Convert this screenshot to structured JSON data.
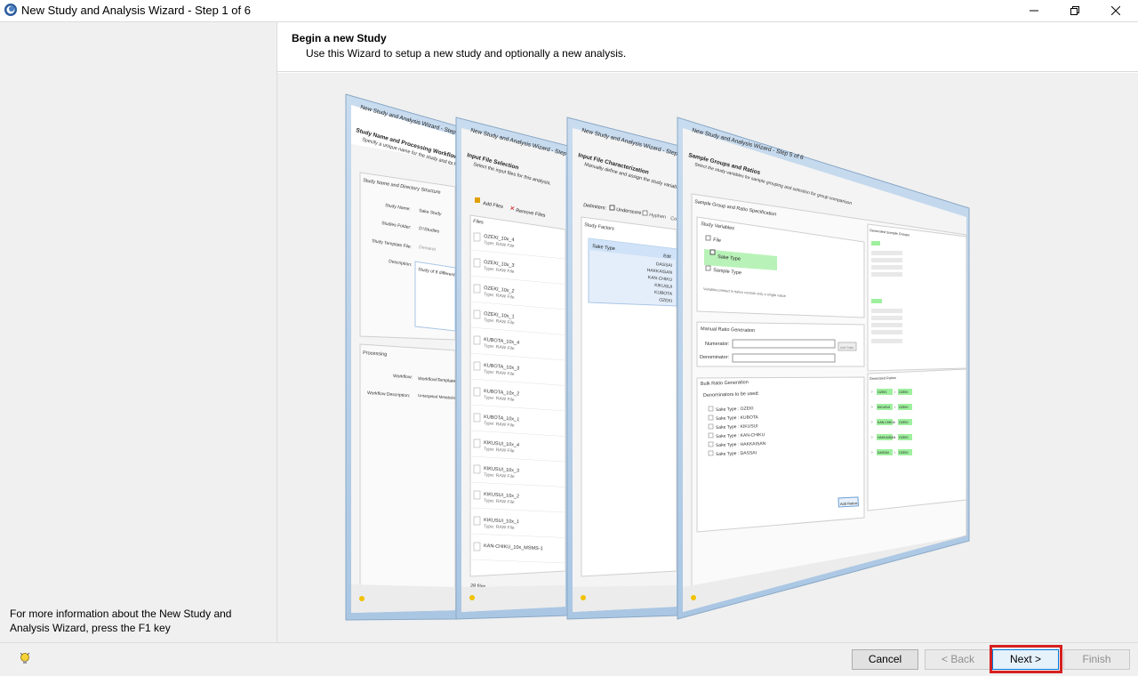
{
  "window": {
    "title": "New Study and Analysis Wizard - Step 1 of 6"
  },
  "header": {
    "title": "Begin a new Study",
    "subtitle": "Use this Wizard to setup a new study and optionally a new analysis."
  },
  "sidebar": {
    "help_text": "For more information about the New Study and Analysis Wizard, press the F1 key"
  },
  "footer": {
    "cancel_label": "Cancel",
    "back_label": "< Back",
    "next_label": "Next >",
    "finish_label": "Finish"
  },
  "preview": {
    "screen1": {
      "window_title": "New Study and Analysis Wizard - Step 2 of 6",
      "heading": "Study Name and Processing Workflow",
      "subheading": "Specify a unique name for the study and its ha",
      "group1": "Study Name and Directory Structure",
      "study_name_label": "Study Name:",
      "study_name_value": "Sake Study",
      "studies_folder_label": "Studies Folder:",
      "studies_folder_value": "D:\\Studies",
      "template_label": "Study Template File:",
      "template_value": "Demand",
      "description_label": "Description:",
      "description_value": "Study of 8 different sa",
      "group2": "Processing",
      "workflow_label": "Workflow:",
      "workflow_value": "Workflow\\Templates\\",
      "workflow_desc_label": "Workflow Description:",
      "workflow_desc_value": "Untargeted Metabolo Background (using bl values, fold change, G"
    },
    "screen2": {
      "window_title": "New Study and Analysis Wizard - Step 3 of 6",
      "heading": "Input File Selection",
      "subheading": "Select the input files for this analysis.",
      "add_files": "Add Files",
      "remove_files": "Remove Files",
      "files_header": "Files",
      "files": [
        {
          "name": "OZEKI_10x_4",
          "type": "Type: RAW File"
        },
        {
          "name": "OZEKI_10x_3",
          "type": "Type: RAW File"
        },
        {
          "name": "OZEKI_10x_2",
          "type": "Type: RAW File"
        },
        {
          "name": "OZEKI_10x_1",
          "type": "Type: RAW File"
        },
        {
          "name": "KUBOTA_10x_4",
          "type": "Type: RAW File"
        },
        {
          "name": "KUBOTA_10x_3",
          "type": "Type: RAW File"
        },
        {
          "name": "KUBOTA_10x_2",
          "type": "Type: RAW File"
        },
        {
          "name": "KUBOTA_10x_1",
          "type": "Type: RAW File"
        },
        {
          "name": "KIKUSUI_10x_4",
          "type": "Type: RAW File"
        },
        {
          "name": "KIKUSUI_10x_3",
          "type": "Type: RAW File"
        },
        {
          "name": "KIKUSUI_10x_2",
          "type": "Type: RAW File"
        },
        {
          "name": "KIKUSUI_10x_1",
          "type": "Type: RAW File"
        },
        {
          "name": "KAN-CHIKU_10x_MSMS-1",
          "type": ""
        }
      ],
      "file_count": "28 files"
    },
    "screen3": {
      "window_title": "New Study and Analysis Wizard - Step 4 of 6",
      "heading": "Input File Characterization",
      "subheading": "Manually define and assign the study variable",
      "delimiters_label": "Delimiters:",
      "underscore": "Underscore",
      "hyphen": "Hyphen",
      "other": "Co",
      "study_factors": "Study Factors",
      "factor": "Sake Type",
      "edit": "Edit",
      "values": [
        "DASSAI",
        "HAKKAISAN",
        "KAN-CHIKU",
        "KIKUSUI",
        "KUBOTA",
        "OZEKI"
      ]
    },
    "screen4": {
      "window_title": "New Study and Analysis Wizard - Step 5 of 6",
      "heading": "Sample Groups and Ratios",
      "subheading": "Select the study variables for sample grouping and selection for group comparison",
      "group_spec": "Sample Group and Ratio Specification",
      "study_variables": "Study Variables",
      "variables": [
        "File",
        "Sake Type",
        "Sample Type"
      ],
      "variables_note": "Variables printed in italics contain only a single value",
      "manual_ratio": "Manual Ratio Generation",
      "numerator": "Numerator:",
      "denominator": "Denominator:",
      "add_ratio": "Add Ratio",
      "bulk_ratio": "Bulk Ratio Generation",
      "denominators_used": "Denominators to be used:",
      "denominators": [
        "Sake Type : OZEKI",
        "Sake Type : KUBOTA",
        "Sake Type : KIKUSUI",
        "Sake Type : KAN-CHIKU",
        "Sake Type : HAKKAISAN",
        "Sake Type : DASSAI"
      ],
      "add_ratios": "Add Ratios",
      "generated_groups": "Generated Sample Groups",
      "generated_ratios": "Generated Ratios",
      "ratio_pairs": [
        [
          "OZEKI",
          "OZEKI"
        ],
        [
          "KIKUSUI",
          "OZEKI"
        ],
        [
          "KAN-CHIKU",
          "OZEKI"
        ],
        [
          "HAKKAISAN",
          "OZEKI"
        ],
        [
          "DASSAI",
          "OZEKI"
        ]
      ]
    }
  }
}
